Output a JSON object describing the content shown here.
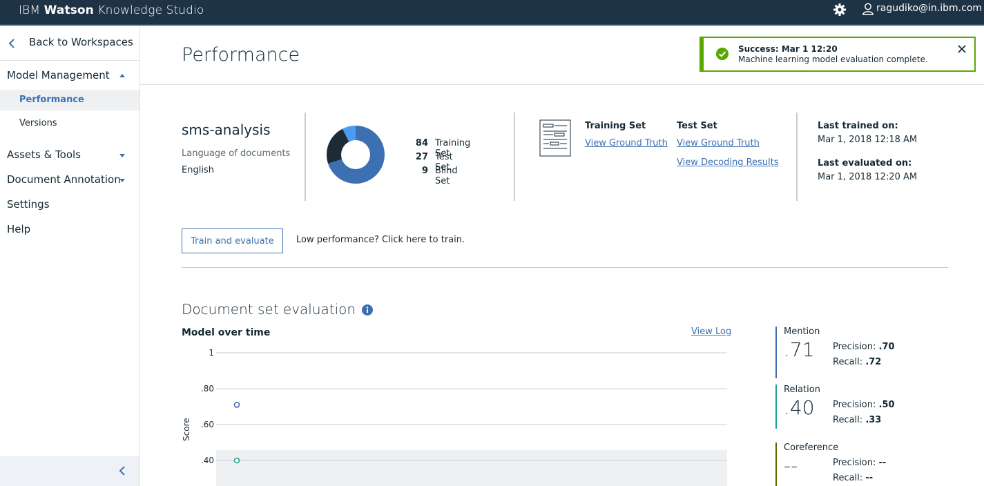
{
  "header": {
    "brand_light": "IBM ",
    "brand_bold": "Watson",
    "brand_rest": " Knowledge Studio",
    "user": "ragudiko@in.ibm.com"
  },
  "sidebar": {
    "back": "Back to Workspaces",
    "sections": [
      {
        "label": "Model Management",
        "expanded": true
      },
      {
        "label": "Assets & Tools",
        "expanded": false
      },
      {
        "label": "Document Annotation",
        "expanded": false
      },
      {
        "label": "Settings"
      },
      {
        "label": "Help"
      }
    ],
    "subitems": [
      {
        "label": "Performance",
        "active": true
      },
      {
        "label": "Versions",
        "active": false
      }
    ]
  },
  "page": {
    "title": "Performance"
  },
  "toast": {
    "title": "Success: Mar 1 12:20",
    "message": "Machine learning model evaluation complete."
  },
  "model": {
    "name": "sms-analysis",
    "language_label": "Language of documents",
    "language": "English"
  },
  "sets": [
    {
      "count": "84",
      "label": "Training Set",
      "color": "#3d70b2"
    },
    {
      "count": "27",
      "label": "Test Set",
      "color": "#1d2b36"
    },
    {
      "count": "9",
      "label": "Blind Set",
      "color": "#4a9cf0"
    }
  ],
  "ground_truth": {
    "training_head": "Training Set",
    "training_link": "View Ground Truth",
    "test_head": "Test Set",
    "test_link": "View Ground Truth",
    "decoding_link": "View Decoding Results"
  },
  "dates": {
    "trained_label": "Last trained on:",
    "trained": "Mar 1, 2018 12:18 AM",
    "evaluated_label": "Last evaluated on:",
    "evaluated": "Mar 1, 2018 12:20 AM"
  },
  "actions": {
    "train_button": "Train and evaluate",
    "train_hint": "Low performance? Click here to train."
  },
  "evaluation": {
    "title": "Document set evaluation",
    "chart_title": "Model over time",
    "view_log": "View Log"
  },
  "chart_data": {
    "type": "scatter",
    "title": "Model over time",
    "ylabel": "Score",
    "yticks": [
      "1",
      ".80",
      ".60",
      ".40"
    ],
    "ylim": [
      0.4,
      1
    ],
    "series": [
      {
        "name": "Mention",
        "color": "#3d70b2",
        "values": [
          0.71
        ]
      },
      {
        "name": "Relation",
        "color": "#1aa68a",
        "values": [
          0.4
        ]
      }
    ]
  },
  "metrics": [
    {
      "name": "Mention",
      "score": ".71",
      "precision_label": "Precision:",
      "precision": ".70",
      "recall_label": "Recall:",
      "recall": ".72",
      "color": "#3d70b2"
    },
    {
      "name": "Relation",
      "score": ".40",
      "precision_label": "Precision:",
      "precision": ".50",
      "recall_label": "Recall:",
      "recall": ".33",
      "color": "#1aa68a"
    },
    {
      "name": "Coreference",
      "score": "--",
      "precision_label": "Precision:",
      "precision": "--",
      "recall_label": "Recall:",
      "recall": "--",
      "color": "#5a6e00"
    }
  ]
}
